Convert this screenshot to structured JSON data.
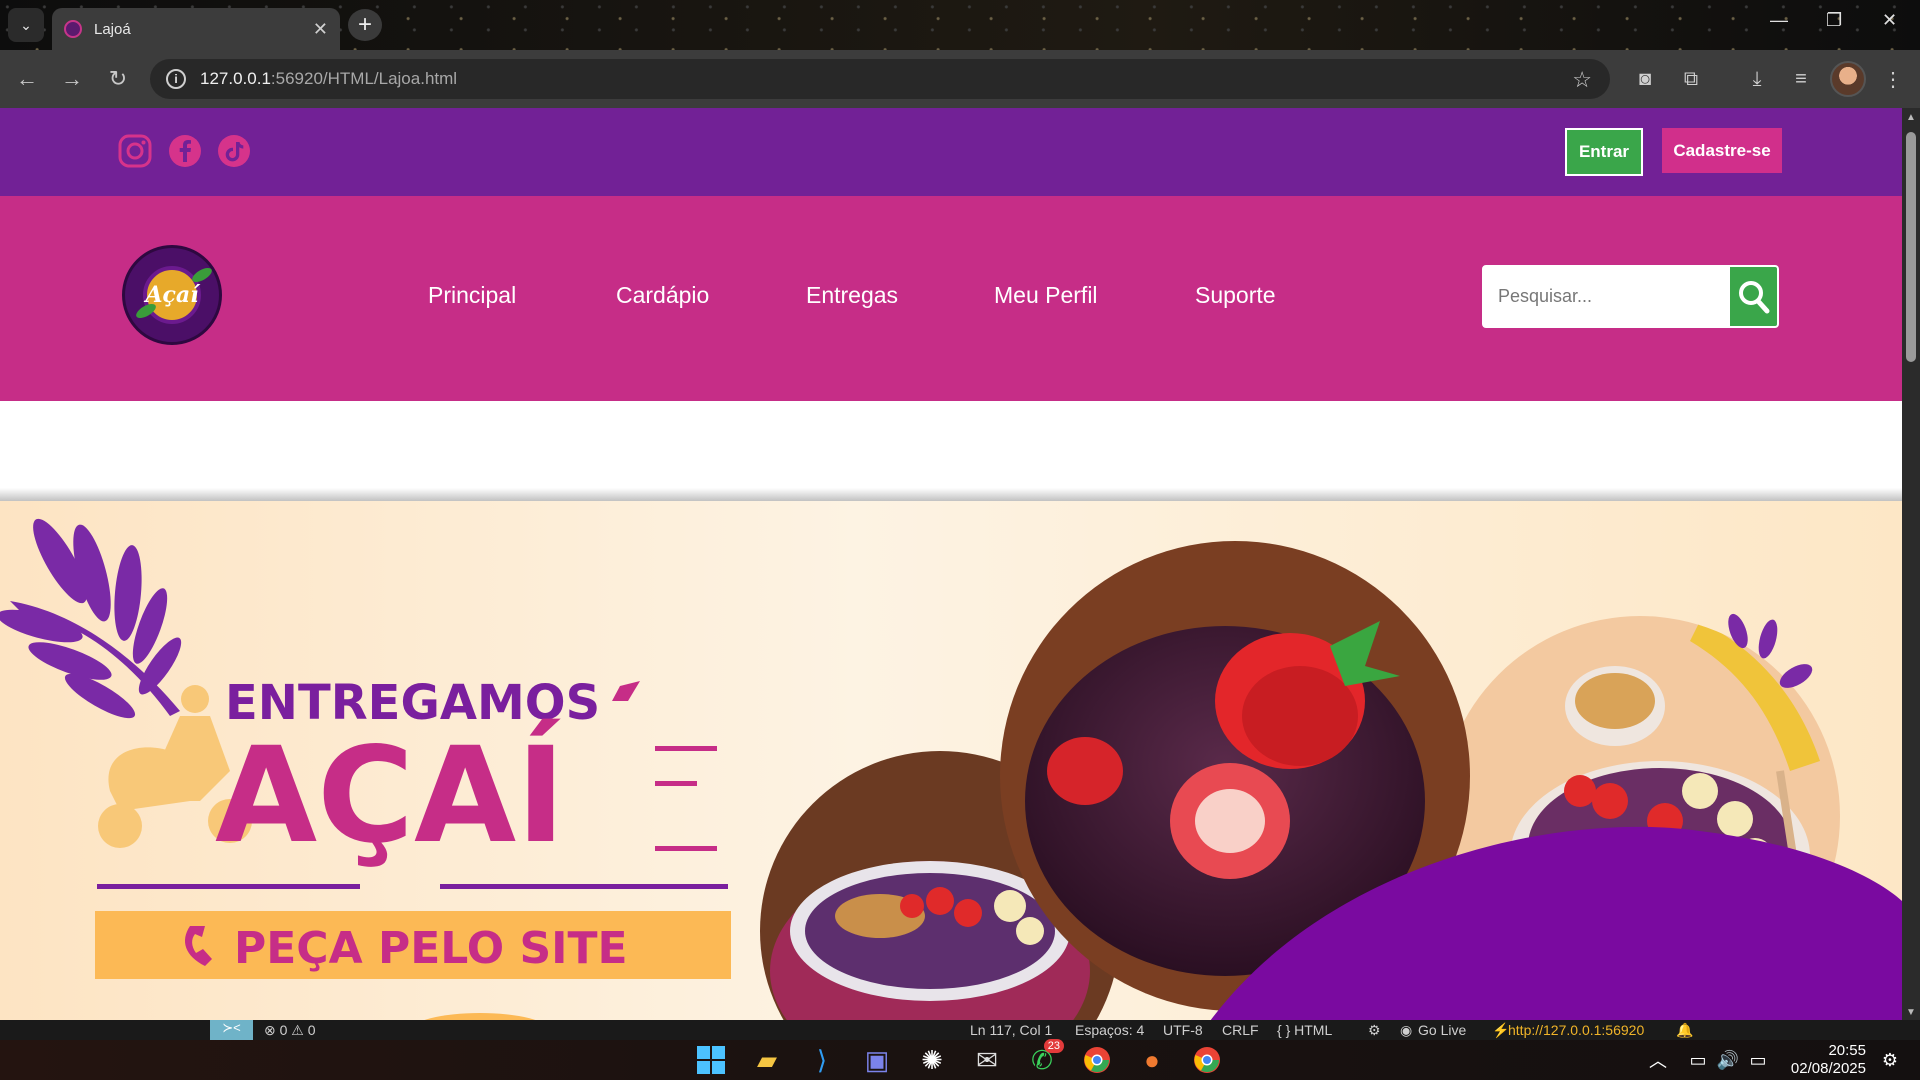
{
  "browser": {
    "tab_title": "Lajoá",
    "url_host": "127.0.0.1",
    "url_rest": ":56920/HTML/Lajoa.html"
  },
  "page": {
    "auth": {
      "login_label": "Entrar",
      "signup_label": "Cadastre-se"
    },
    "social": [
      "instagram-icon",
      "facebook-icon",
      "tiktok-icon"
    ],
    "logo_text": "Açaí",
    "nav": [
      {
        "label": "Principal"
      },
      {
        "label": "Cardápio"
      },
      {
        "label": "Entregas"
      },
      {
        "label": "Meu Perfil"
      },
      {
        "label": "Suporte"
      }
    ],
    "search": {
      "placeholder": "Pesquisar..."
    },
    "banner": {
      "headline_small": "ENTREGAMOS",
      "headline_big": "AÇAÍ",
      "cta": "PEÇA PELO SITE"
    },
    "colors": {
      "topbar": "#722196",
      "nav": "#c62d87",
      "green": "#3aa64a",
      "pink": "#d12f8b"
    }
  },
  "status": {
    "errors": "⊗ 0 ⚠ 0",
    "position": "Ln 117, Col 1",
    "spaces": "Espaços: 4",
    "encoding": "UTF-8",
    "eol": "CRLF",
    "language": "{ } HTML",
    "golive": "Go Live",
    "server": "http://127.0.0.1:56920"
  },
  "taskbar": {
    "whatsapp_badge": "23",
    "time": "20:55",
    "date": "02/08/2025"
  }
}
